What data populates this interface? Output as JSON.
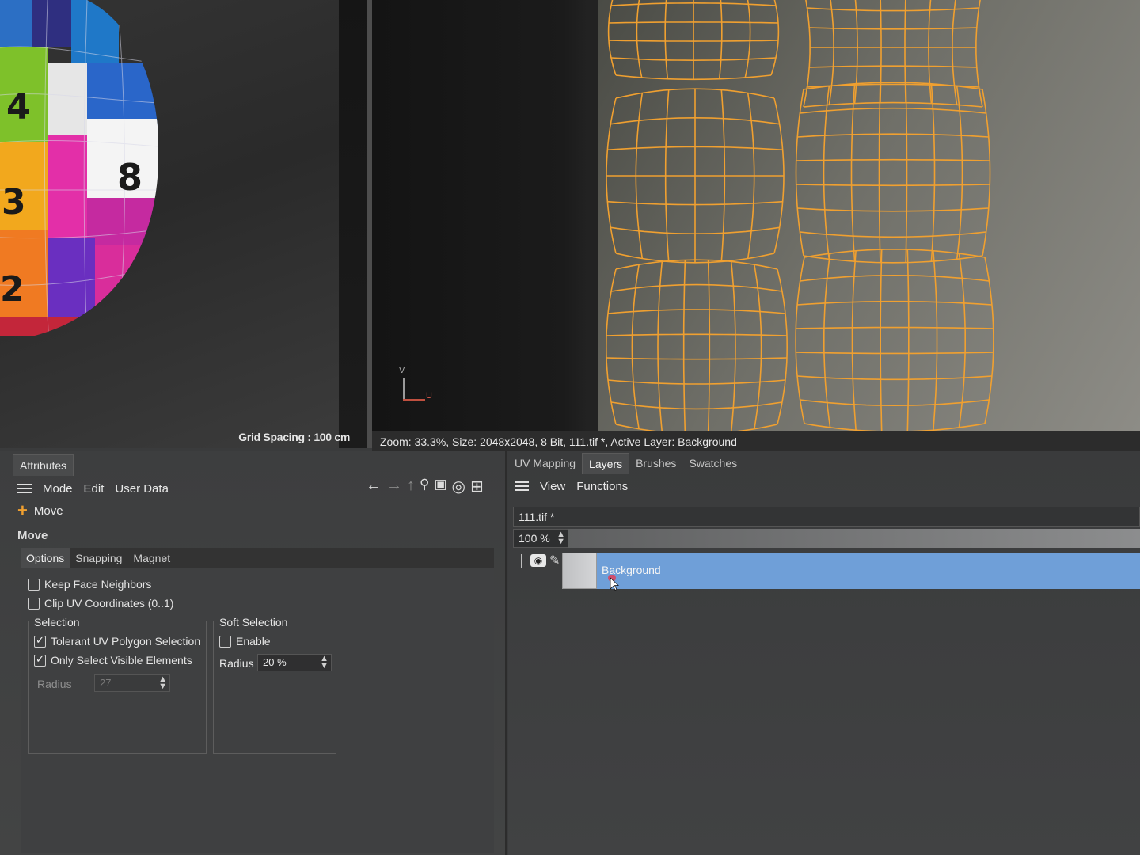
{
  "viewport3d": {
    "grid_spacing": "Grid Spacing : 100 cm",
    "sphere_labels": [
      "4",
      "8",
      "3",
      "2"
    ]
  },
  "uv_view": {
    "axis_v": "V",
    "axis_u": "U",
    "status": "Zoom: 33.3%, Size: 2048x2048, 8 Bit, 111.tif *, Active Layer: Background",
    "mesh_color": "#f0a030"
  },
  "attributes": {
    "tab": "Attributes",
    "menu": {
      "mode": "Mode",
      "edit": "Edit",
      "user_data": "User Data"
    },
    "toolbar": {
      "back": "←",
      "forward": "→",
      "up": "↑",
      "search": "🔍",
      "lock": "🔒",
      "target": "◎",
      "new": "⊞"
    },
    "tool_name": "Move",
    "tool_heading": "Move",
    "subtabs": [
      "Options",
      "Snapping",
      "Magnet"
    ],
    "options": {
      "keep_face_neighbors": {
        "label": "Keep Face Neighbors",
        "checked": false
      },
      "clip_uv": {
        "label": "Clip UV Coordinates (0..1)",
        "checked": false
      },
      "selection": {
        "title": "Selection",
        "tolerant": {
          "label": "Tolerant UV Polygon Selection",
          "checked": true
        },
        "only_visible": {
          "label": "Only Select Visible Elements",
          "checked": true
        },
        "radius_label": "Radius",
        "radius_value": "27"
      },
      "soft_selection": {
        "title": "Soft Selection",
        "enable": {
          "label": "Enable",
          "checked": false
        },
        "radius_label": "Radius",
        "radius_value": "20 %"
      }
    }
  },
  "layers": {
    "tabs": [
      "UV Mapping",
      "Layers",
      "Brushes",
      "Swatches"
    ],
    "active_tab": "Layers",
    "menu": {
      "view": "View",
      "functions": "Functions"
    },
    "file_name": "111.tif *",
    "opacity": "100 %",
    "layer_name": "Background",
    "layer_color": "#6f9fd8"
  }
}
